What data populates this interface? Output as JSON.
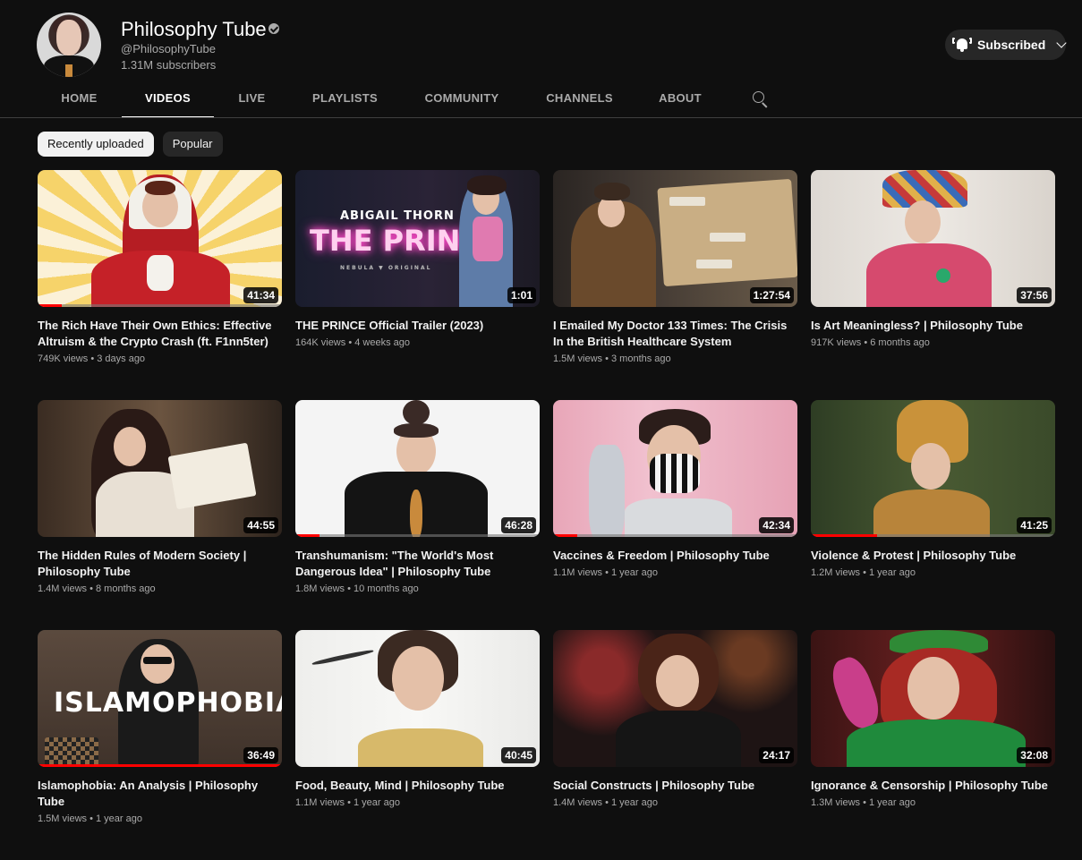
{
  "channel": {
    "name": "Philosophy Tube",
    "handle": "@PhilosophyTube",
    "subscribers": "1.31M subscribers",
    "subscribe_label": "Subscribed"
  },
  "tabs": [
    "HOME",
    "VIDEOS",
    "LIVE",
    "PLAYLISTS",
    "COMMUNITY",
    "CHANNELS",
    "ABOUT"
  ],
  "active_tab": "VIDEOS",
  "chips": [
    "Recently uploaded",
    "Popular"
  ],
  "videos": [
    {
      "title": "The Rich Have Their Own Ethics: Effective Altruism & the Crypto Crash (ft. F1nn5ter)",
      "views": "749K views",
      "age": "3 days ago",
      "duration": "41:34",
      "watched": 0.1
    },
    {
      "title": "THE PRINCE Official Trailer (2023)",
      "views": "164K views",
      "age": "4 weeks ago",
      "duration": "1:01",
      "watched": 0,
      "thumb_caption": "ABIGAIL THORN",
      "thumb_title": "THE PRINCE",
      "thumb_footer": "NEBULA ▼ ORIGINAL"
    },
    {
      "title": "I Emailed My Doctor 133 Times: The Crisis In the British Healthcare System",
      "views": "1.5M views",
      "age": "3 months ago",
      "duration": "1:27:54",
      "watched": 0
    },
    {
      "title": "Is Art Meaningless? | Philosophy Tube",
      "views": "917K views",
      "age": "6 months ago",
      "duration": "37:56",
      "watched": 0
    },
    {
      "title": "The Hidden Rules of Modern Society | Philosophy Tube",
      "views": "1.4M views",
      "age": "8 months ago",
      "duration": "44:55",
      "watched": 0
    },
    {
      "title": "Transhumanism: \"The World's Most Dangerous Idea\" | Philosophy Tube",
      "views": "1.8M views",
      "age": "10 months ago",
      "duration": "46:28",
      "watched": 0.1
    },
    {
      "title": "Vaccines & Freedom | Philosophy Tube",
      "views": "1.1M views",
      "age": "1 year ago",
      "duration": "42:34",
      "watched": 0.1
    },
    {
      "title": "Violence & Protest | Philosophy Tube",
      "views": "1.2M views",
      "age": "1 year ago",
      "duration": "41:25",
      "watched": 0.27
    },
    {
      "title": "Islamophobia: An Analysis | Philosophy Tube",
      "views": "1.5M views",
      "age": "1 year ago",
      "duration": "36:49",
      "watched": 1.0,
      "thumb_title": "ISLAMOPHOBIA"
    },
    {
      "title": "Food, Beauty, Mind | Philosophy Tube",
      "views": "1.1M views",
      "age": "1 year ago",
      "duration": "40:45",
      "watched": 0
    },
    {
      "title": "Social Constructs | Philosophy Tube",
      "views": "1.4M views",
      "age": "1 year ago",
      "duration": "24:17",
      "watched": 0
    },
    {
      "title": "Ignorance & Censorship | Philosophy Tube",
      "views": "1.3M views",
      "age": "1 year ago",
      "duration": "32:08",
      "watched": 0
    }
  ],
  "colors": {
    "background": "#0f0f0f",
    "progress": "#ff0000",
    "chip_selected": "#f1f1f1"
  }
}
